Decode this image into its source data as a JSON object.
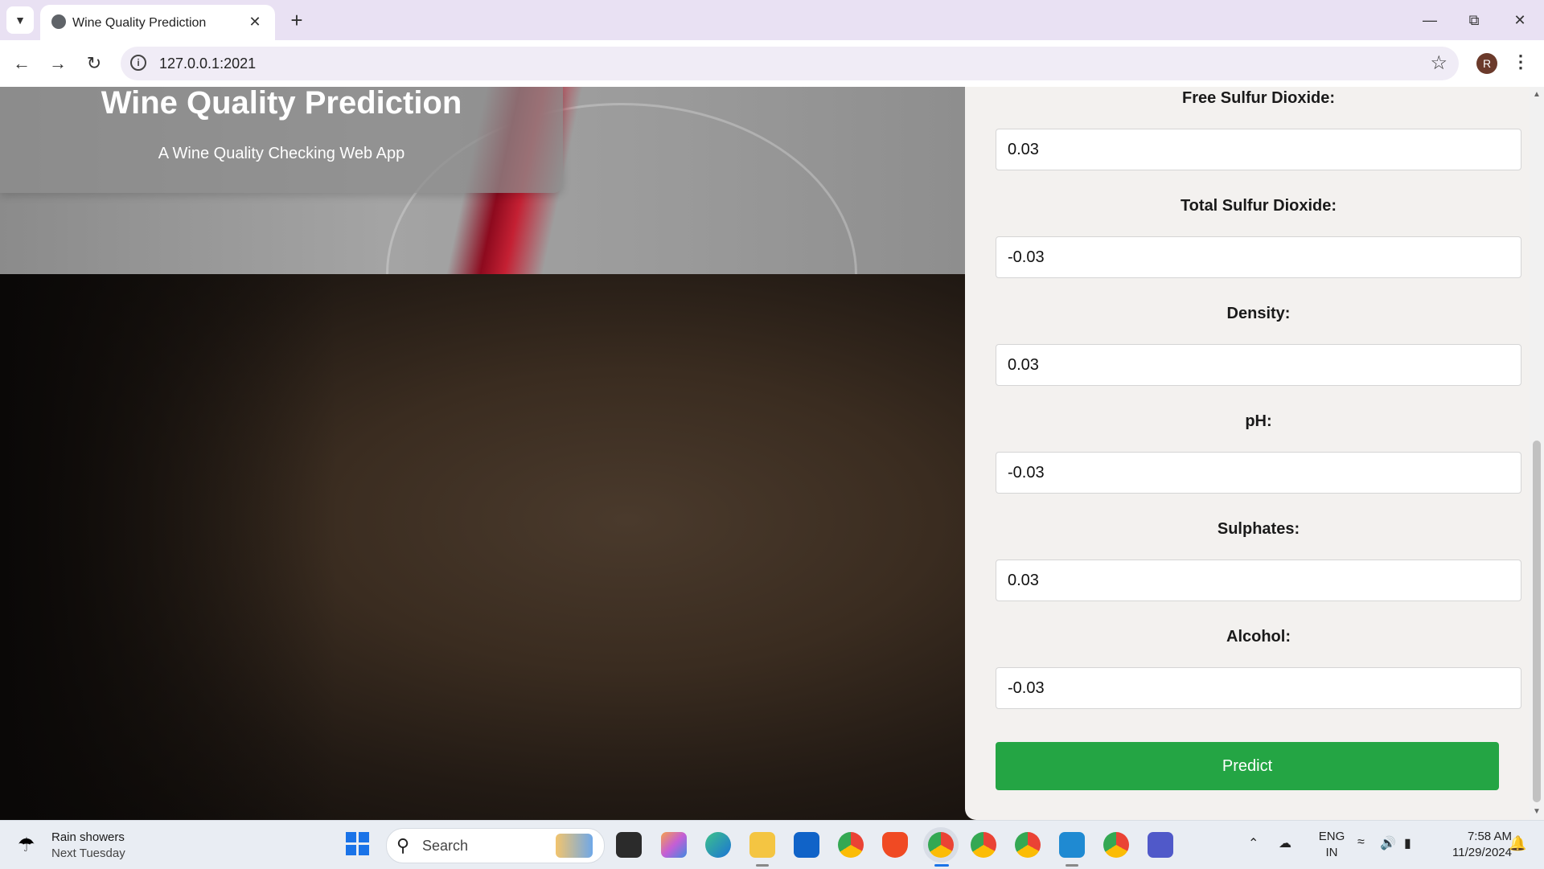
{
  "browser": {
    "tab_title": "Wine Quality Prediction",
    "url": "127.0.0.1:2021",
    "profile_initial": "R"
  },
  "page": {
    "title": "Wine Quality Prediction",
    "subtitle": "A Wine Quality Checking Web App",
    "fields": [
      {
        "label": "Free Sulfur Dioxide:",
        "value": "0.03"
      },
      {
        "label": "Total Sulfur Dioxide:",
        "value": "-0.03"
      },
      {
        "label": "Density:",
        "value": "0.03"
      },
      {
        "label": "pH:",
        "value": "-0.03"
      },
      {
        "label": "Sulphates:",
        "value": "0.03"
      },
      {
        "label": "Alcohol:",
        "value": "-0.03"
      }
    ],
    "predict_label": "Predict",
    "accent_color": "#24a544"
  },
  "taskbar": {
    "weather_line1": "Rain showers",
    "weather_line2": "Next Tuesday",
    "search_placeholder": "Search",
    "lang_line1": "ENG",
    "lang_line2": "IN",
    "time": "7:58 AM",
    "date": "11/29/2024",
    "apps": [
      "task-view",
      "copilot",
      "edge",
      "file-explorer",
      "outlook",
      "chrome",
      "brave",
      "chrome-profile-r",
      "chrome-profile-2",
      "chrome-profile-3",
      "vscode",
      "chrome-profile-k",
      "teams"
    ]
  }
}
